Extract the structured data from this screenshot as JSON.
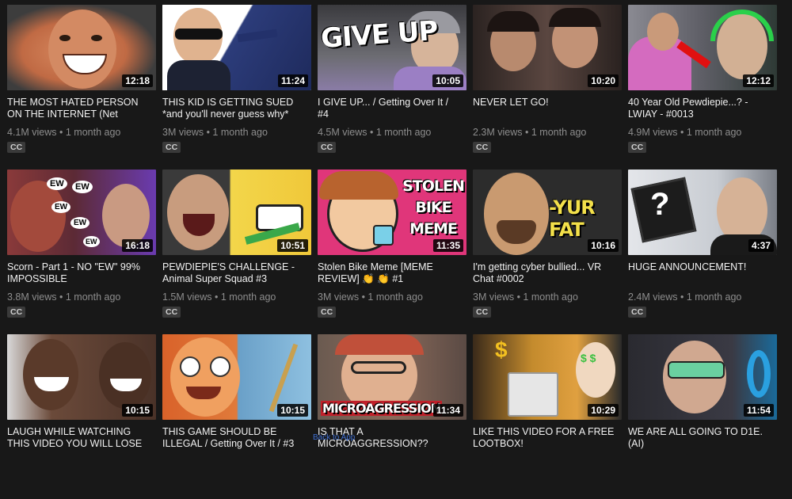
{
  "videos": [
    {
      "title": "THE MOST HATED PERSON ON THE INTERNET (Net",
      "views": "4.1M views",
      "age": "1 month ago",
      "duration": "12:18",
      "cc": "CC",
      "bg": "#d97d5b"
    },
    {
      "title": "THIS KID IS GETTING SUED *and you'll never guess why*",
      "views": "3M views",
      "age": "1 month ago",
      "duration": "11:24",
      "cc": "CC",
      "bg": "#2d3b6e"
    },
    {
      "title": "I GIVE UP... / Getting Over It / #4",
      "views": "4.5M views",
      "age": "1 month ago",
      "duration": "10:05",
      "cc": "CC",
      "bg": "#5b5b62",
      "overlay": "GIVE UP"
    },
    {
      "title": "NEVER LET GO!",
      "views": "2.3M views",
      "age": "1 month ago",
      "duration": "10:20",
      "cc": "CC",
      "bg": "#3b2e2b"
    },
    {
      "title": "40 Year Old Pewdiepie...? - LWIAY - #0013",
      "views": "4.9M views",
      "age": "1 month ago",
      "duration": "12:12",
      "cc": "CC",
      "bg": "#6a6a70"
    },
    {
      "title": "Scorn - Part 1 - NO \"EW\" 99% IMPOSSIBLE",
      "views": "3.8M views",
      "age": "1 month ago",
      "duration": "16:18",
      "cc": "CC",
      "bg": "#5a2d3b"
    },
    {
      "title": "PEWDIEPIE'S CHALLENGE - Animal Super Squad #3",
      "views": "1.5M views",
      "age": "1 month ago",
      "duration": "10:51",
      "cc": "CC",
      "bg": "#e7c93a"
    },
    {
      "title": "Stolen Bike Meme [MEME REVIEW] 👏 👏 #1",
      "views": "3M views",
      "age": "1 month ago",
      "duration": "11:35",
      "cc": "CC",
      "bg": "#e0367a",
      "overlay": "STOLEN BIKE MEME"
    },
    {
      "title": "I'm getting cyber bullied... VR Chat #0002",
      "views": "3M views",
      "age": "1 month ago",
      "duration": "10:16",
      "cc": "CC",
      "bg": "#2a2a2a",
      "overlay": "-YUR FAT"
    },
    {
      "title": "HUGE ANNOUNCEMENT!",
      "views": "2.4M views",
      "age": "1 month ago",
      "duration": "4:37",
      "cc": "CC",
      "bg": "#cfd3d8"
    },
    {
      "title": "LAUGH WHILE WATCHING THIS VIDEO YOU WILL LOSE",
      "views": "",
      "age": "",
      "duration": "10:15",
      "cc": "",
      "bg": "#6b4a3a"
    },
    {
      "title": "THIS GAME SHOULD BE ILLEGAL / Getting Over It / #3",
      "views": "",
      "age": "",
      "duration": "10:15",
      "cc": "",
      "bg": "#d9622a"
    },
    {
      "title": "IS THAT A MICROAGGRESSION??",
      "views": "",
      "age": "",
      "duration": "11:34",
      "cc": "",
      "bg": "#7a5a4c",
      "overlay": "MICROAGRESSION"
    },
    {
      "title": "LIKE THIS VIDEO FOR A FREE LOOTBOX!",
      "views": "",
      "age": "",
      "duration": "10:29",
      "cc": "",
      "bg": "#c48b2d"
    },
    {
      "title": "WE ARE ALL GOING TO D1E. (AI)",
      "views": "",
      "age": "",
      "duration": "11:54",
      "cc": "",
      "bg": "#2f2f35"
    }
  ],
  "separator": " • ",
  "back_link": "Back to App"
}
